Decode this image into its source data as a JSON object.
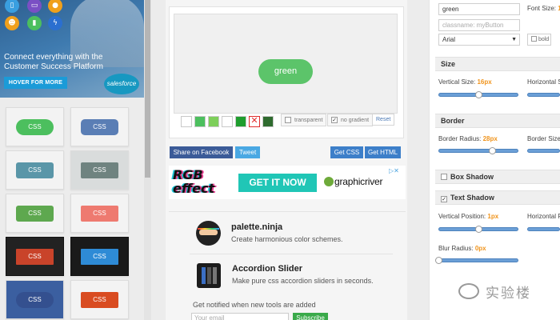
{
  "ad": {
    "headline": "Connect everything with the Customer Success Platform",
    "button": "HOVER FOR MORE",
    "brand": "salesforce",
    "icons": [
      "phone-icon",
      "chat-icon",
      "location-icon",
      "people-icon",
      "chart-icon",
      "bolt-icon"
    ]
  },
  "swatches": [
    {
      "label": "CSS",
      "bg": "#4cbf5e"
    },
    {
      "label": "CSS",
      "bg": "#5a7eb5"
    },
    {
      "label": "CSS",
      "bg": "#5a96a8"
    },
    {
      "label": "CSS",
      "bg": "#6f8380"
    },
    {
      "label": "CSS",
      "bg": "#5ea84f"
    },
    {
      "label": "CSS",
      "bg": "#ee7a70"
    },
    {
      "label": "CSS",
      "bg": "#c9432a"
    },
    {
      "label": "CSS",
      "bg": "#2e8bd6"
    },
    {
      "label": "CSS",
      "bg": "#34508f"
    },
    {
      "label": "CSS",
      "bg": "#d94c21"
    }
  ],
  "preview": {
    "button_text": "green",
    "button_color": "#5cc46a",
    "color_swatches": [
      "#ffffff",
      "#4cbf5e",
      "#7dcf5a",
      "#ffffff",
      "#1f9d2e",
      "#e02b2b",
      "#2f6b2f"
    ],
    "transparent_label": "transparent",
    "no_gradient_label": "no gradient",
    "no_gradient_checked": "✓",
    "reset_label": "Reset"
  },
  "share": {
    "facebook": "Share on Facebook",
    "tweet": "Tweet",
    "get_css": "Get CSS",
    "get_html": "Get HTML"
  },
  "banner": {
    "rgb_line1": "RGB",
    "rgb_line2": "effect",
    "cta": "GET IT NOW",
    "brand": "graphicriver"
  },
  "products": [
    {
      "title": "palette.ninja",
      "subtitle": "Create harmonious color schemes."
    },
    {
      "title": "Accordion Slider",
      "subtitle": "Make pure css accordion sliders in seconds."
    }
  ],
  "newsletter": {
    "prompt": "Get notified when new tools are added",
    "email_placeholder": "Your email",
    "subscribe": "Subscribe"
  },
  "settings": {
    "text_value": "green",
    "classname_placeholder": "classname: myButton",
    "font_family": "Arial",
    "font_size_label": "Font Size:",
    "font_size_value": "1",
    "bold_label": "bold",
    "size_section": "Size",
    "vertical_size_label": "Vertical Size:",
    "vertical_size_value": "16px",
    "horizontal_size_label": "Horizontal S",
    "border_section": "Border",
    "border_radius_label": "Border Radius:",
    "border_radius_value": "28px",
    "border_size_label": "Border Size",
    "box_shadow_section": "Box Shadow",
    "text_shadow_section": "Text Shadow",
    "text_shadow_checked": "✓",
    "vertical_position_label": "Vertical Position:",
    "vertical_position_value": "1px",
    "horizontal_position_label": "Horizontal P",
    "blur_radius_label": "Blur Radius:",
    "blur_radius_value": "0px",
    "sliders": {
      "vertical_size": 0.5,
      "border_radius": 0.67,
      "vertical_position": 0.5,
      "blur_radius": 0.0
    }
  },
  "watermark": "实验楼"
}
